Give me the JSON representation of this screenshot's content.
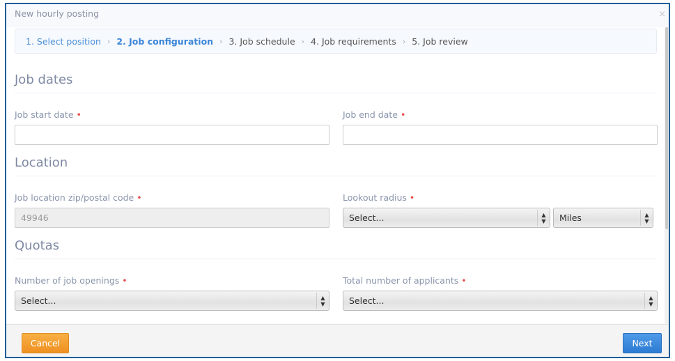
{
  "dialog": {
    "title": "New hourly posting",
    "close": "×"
  },
  "steps": [
    {
      "label": "1. Select position",
      "state": "done"
    },
    {
      "label": "2. Job configuration",
      "state": "active"
    },
    {
      "label": "3. Job schedule",
      "state": "pending"
    },
    {
      "label": "4. Job requirements",
      "state": "pending"
    },
    {
      "label": "5. Job review",
      "state": "pending"
    }
  ],
  "sections": {
    "dates": "Job dates",
    "location": "Location",
    "quotas": "Quotas"
  },
  "fields": {
    "start_date": {
      "label": "Job start date",
      "value": ""
    },
    "end_date": {
      "label": "Job end date",
      "value": ""
    },
    "zip": {
      "label": "Job location zip/postal code",
      "value": "49946"
    },
    "radius": {
      "label": "Lookout radius",
      "value": "Select...",
      "unit": "Miles"
    },
    "openings": {
      "label": "Number of job openings",
      "value": "Select..."
    },
    "applicants": {
      "label": "Total number of applicants",
      "value": "Select..."
    }
  },
  "required_mark": "•",
  "footer": {
    "cancel": "Cancel",
    "next": "Next"
  },
  "colors": {
    "accent": "#3b86d8",
    "cancel": "#f0981f",
    "next": "#2f80d6",
    "required": "#e84b4b",
    "border": "#1d5f9a"
  }
}
